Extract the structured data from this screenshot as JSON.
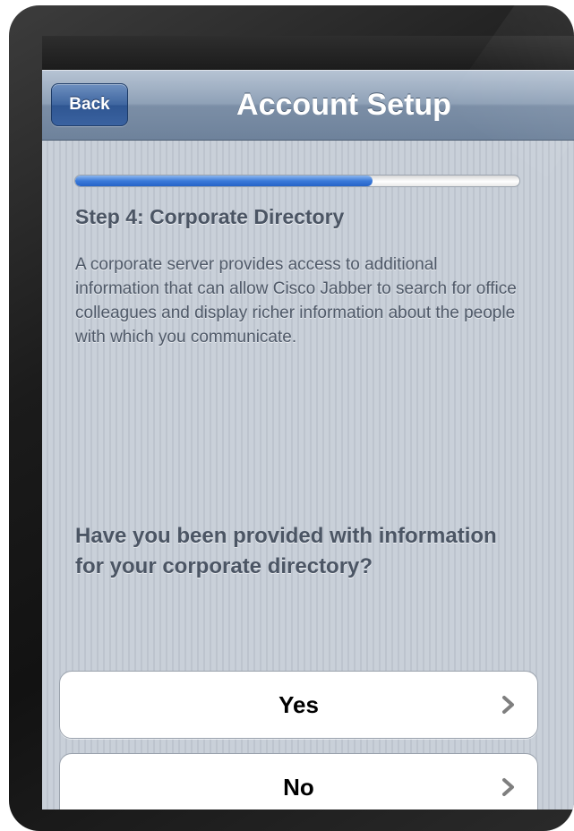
{
  "nav": {
    "back_label": "Back",
    "title": "Account Setup"
  },
  "progress": {
    "fraction": 0.67
  },
  "step": {
    "title": "Step 4: Corporate Directory",
    "description": "A corporate server provides access to additional information that can allow Cisco Jabber to search for office colleagues and display richer information about the people with which you communicate."
  },
  "question": "Have you been provided with information for your corporate directory?",
  "choices": [
    {
      "label": "Yes",
      "icon": "chevron-right-icon"
    },
    {
      "label": "No",
      "icon": "chevron-right-icon"
    }
  ],
  "colors": {
    "nav_bar": "#8fa1b7",
    "back_button": "#3f66a0",
    "progress_fill": "#3b7ad9",
    "text": "#4b5564"
  }
}
